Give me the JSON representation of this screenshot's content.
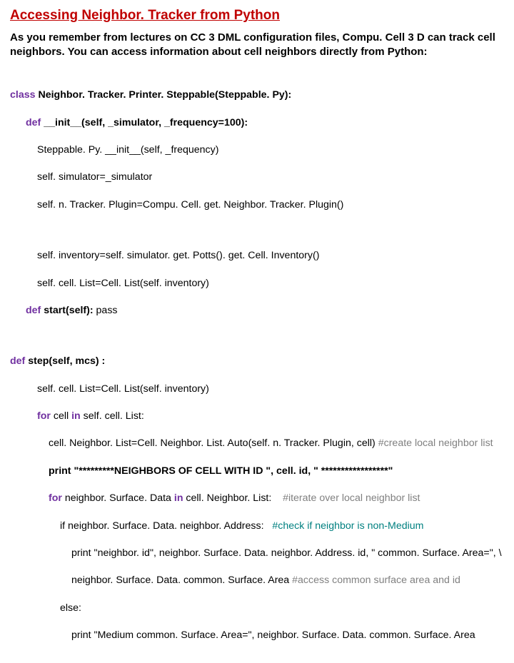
{
  "title": "Accessing Neighbor. Tracker from Python",
  "intro": "As you remember from lectures on CC 3 DML configuration files, Compu. Cell 3 D can track cell neighbors. You can access information about cell neighbors directly from Python:",
  "code": {
    "l1a": "class",
    "l1b": " Neighbor. Tracker. Printer. Steppable(Steppable. Py):",
    "l2a": "def",
    "l2b": " __init__(self, _simulator, _frequency=100):",
    "l3": "Steppable. Py. __init__(self, _frequency)",
    "l4": "self. simulator=_simulator",
    "l5": "self. n. Tracker. Plugin=Compu. Cell. get. Neighbor. Tracker. Plugin()",
    "l6": "self. inventory=self. simulator. get. Potts(). get. Cell. Inventory()",
    "l7": "self. cell. List=Cell. List(self. inventory)",
    "l8a": "def",
    "l8b": " start(self): ",
    "l8c": "pass",
    "l9a": "def",
    "l9b": " step(self, mcs) :",
    "l10": "self. cell. List=Cell. List(self. inventory)",
    "l11a": "for",
    "l11b": " cell ",
    "l11c": "in",
    "l11d": " self. cell. List:",
    "l12a": "cell. Neighbor. List=Cell. Neighbor. List. Auto(self. n. Tracker. Plugin, cell) ",
    "l12b": "#create local neighbor list",
    "l13": "print \"*********NEIGHBORS OF CELL WITH ID \", cell. id, \" *****************\"",
    "l14a": "for",
    "l14b": " neighbor. Surface. Data ",
    "l14c": "in",
    "l14d": " cell. Neighbor. List:    ",
    "l14e": "#iterate over local neighbor list",
    "l15a": "if neighbor. Surface. Data. neighbor. Address:   ",
    "l15b": "#check if neighbor is non-Medium",
    "l16": "print \"neighbor. id\", neighbor. Surface. Data. neighbor. Address. id, \" common. Surface. Area=\", \\",
    "l17a": "neighbor. Surface. Data. common. Surface. Area ",
    "l17b": "#access common surface area and id",
    "l18": "else:",
    "l19": "print \"Medium common. Surface. Area=\", neighbor. Surface. Data. common. Surface. Area"
  }
}
